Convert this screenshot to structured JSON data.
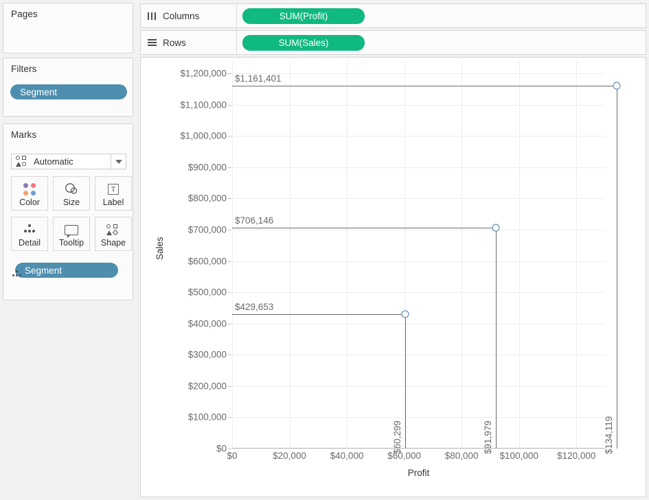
{
  "sidebar": {
    "pages": {
      "title": "Pages"
    },
    "filters": {
      "title": "Filters",
      "pills": [
        {
          "label": "Segment",
          "color": "#4e8eaf"
        }
      ]
    },
    "marks": {
      "title": "Marks",
      "type_selector": {
        "value": "Automatic",
        "icon": "marks-shape-icon"
      },
      "buttons": [
        {
          "label": "Color",
          "icon": "color-dots-icon"
        },
        {
          "label": "Size",
          "icon": "size-circles-icon"
        },
        {
          "label": "Label",
          "icon": "label-text-icon"
        },
        {
          "label": "Detail",
          "icon": "detail-dots-icon"
        },
        {
          "label": "Tooltip",
          "icon": "tooltip-bubble-icon"
        },
        {
          "label": "Shape",
          "icon": "shape-glyph-icon"
        }
      ],
      "pills": [
        {
          "label": "Segment",
          "color": "#4e8eaf",
          "icon": "detail-dots-icon"
        }
      ]
    }
  },
  "shelves": [
    {
      "name": "Columns",
      "icon": "columns-icon",
      "pill": {
        "label": "SUM(Profit)",
        "color": "#10b981"
      }
    },
    {
      "name": "Rows",
      "icon": "rows-icon",
      "pill": {
        "label": "SUM(Sales)",
        "color": "#10b981"
      }
    }
  ],
  "chart_data": {
    "type": "scatter",
    "title": "",
    "xlabel": "Profit",
    "ylabel": "Sales",
    "xlim": [
      0,
      130000
    ],
    "ylim": [
      0,
      1240000
    ],
    "grid": true,
    "legend": null,
    "xticks": [
      {
        "value": 0,
        "label": "$0"
      },
      {
        "value": 20000,
        "label": "$20,000"
      },
      {
        "value": 40000,
        "label": "$40,000"
      },
      {
        "value": 60000,
        "label": "$60,000"
      },
      {
        "value": 80000,
        "label": "$80,000"
      },
      {
        "value": 100000,
        "label": "$100,000"
      },
      {
        "value": 120000,
        "label": "$120,000"
      }
    ],
    "yticks": [
      {
        "value": 0,
        "label": "$0"
      },
      {
        "value": 100000,
        "label": "$100,000"
      },
      {
        "value": 200000,
        "label": "$200,000"
      },
      {
        "value": 300000,
        "label": "$300,000"
      },
      {
        "value": 400000,
        "label": "$400,000"
      },
      {
        "value": 500000,
        "label": "$500,000"
      },
      {
        "value": 600000,
        "label": "$600,000"
      },
      {
        "value": 700000,
        "label": "$700,000"
      },
      {
        "value": 800000,
        "label": "$800,000"
      },
      {
        "value": 900000,
        "label": "$900,000"
      },
      {
        "value": 1000000,
        "label": "$1,000,000"
      },
      {
        "value": 1100000,
        "label": "$1,100,000"
      },
      {
        "value": 1200000,
        "label": "$1,200,000"
      }
    ],
    "points": [
      {
        "x": 134119,
        "y": 1161401,
        "x_label": "$134,119",
        "y_label": "$1,161,401",
        "marker": "open-circle",
        "color": "#4a7ba7"
      },
      {
        "x": 91979,
        "y": 706146,
        "x_label": "$91,979",
        "y_label": "$706,146",
        "marker": "open-circle",
        "color": "#4a7ba7"
      },
      {
        "x": 60299,
        "y": 429653,
        "x_label": "$60,299",
        "y_label": "$429,653",
        "marker": "open-circle",
        "color": "#4a7ba7"
      }
    ]
  }
}
